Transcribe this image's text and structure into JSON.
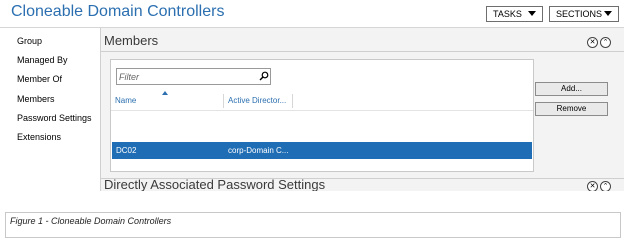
{
  "header": {
    "title": "Cloneable Domain Controllers",
    "tasks_label": "TASKS",
    "sections_label": "SECTIONS"
  },
  "sidebar": {
    "items": [
      {
        "label": "Group"
      },
      {
        "label": "Managed By"
      },
      {
        "label": "Member Of"
      },
      {
        "label": "Members"
      },
      {
        "label": "Password Settings"
      },
      {
        "label": "Extensions"
      }
    ]
  },
  "members": {
    "title": "Members",
    "filter_placeholder": "Filter",
    "columns": [
      "Name",
      "Active Director..."
    ],
    "rows": [
      {
        "name": "DC02",
        "active_directory": "corp-Domain C...",
        "selected": true
      }
    ],
    "buttons": {
      "add": "Add...",
      "remove": "Remove"
    }
  },
  "password_section": {
    "title": "Directly Associated Password Settings"
  },
  "caption": "Figure 1 - Cloneable Domain Controllers",
  "colors": {
    "accent": "#2b6fb0",
    "selection": "#1f6db5"
  },
  "icons": [
    "chevron-down-icon",
    "close-icon",
    "collapse-icon",
    "search-icon",
    "sort-ascending-icon"
  ]
}
